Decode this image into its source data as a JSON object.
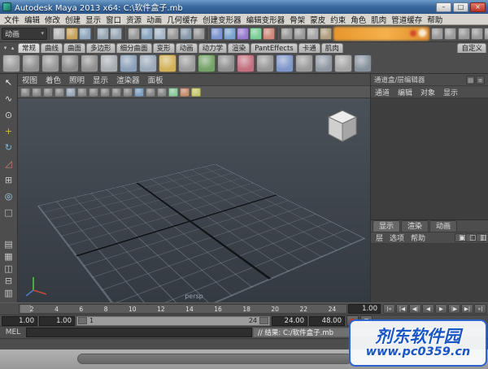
{
  "colors": {
    "titlebar_blue": "#3a6aa0",
    "ui_gray": "#4d4d4d",
    "viewport_bg": "#3e444b",
    "censor_orange": "#eb9c30",
    "watermark_blue": "#1a56c4",
    "field_bg": "#2b2b2b"
  },
  "window": {
    "title": "Autodesk Maya 2013 x64: C:\\软件盒子.mb",
    "controls": [
      {
        "name": "minimize-button",
        "glyph": "–"
      },
      {
        "name": "maximize-button",
        "glyph": "□"
      },
      {
        "name": "close-button",
        "glyph": "×"
      }
    ]
  },
  "menu_bar": {
    "items": [
      "文件",
      "编辑",
      "修改",
      "创建",
      "显示",
      "窗口",
      "资源",
      "动画",
      "几何缓存",
      "创建变形器",
      "编辑变形器",
      "骨架",
      "蒙皮",
      "约束",
      "角色",
      "肌肉",
      "管道缓存",
      "帮助"
    ]
  },
  "status_line": {
    "menu_set": "动画",
    "caret": "▾",
    "file_icons": [
      {
        "name": "new-scene-icon",
        "color": "#b8b8b8"
      },
      {
        "name": "open-scene-icon",
        "color": "#c9a45f"
      },
      {
        "name": "save-scene-icon",
        "color": "#8fa8bf"
      }
    ],
    "edit_icons": [
      {
        "name": "undo-icon",
        "color": "#9aa8b5"
      },
      {
        "name": "redo-icon",
        "color": "#9aa8b5"
      }
    ],
    "selection_icons": [
      {
        "name": "select-hierarchy-icon",
        "color": "#9a9a9a"
      },
      {
        "name": "select-object-icon",
        "color": "#8aa6c0"
      },
      {
        "name": "select-component-icon",
        "color": "#a8b8c8"
      },
      {
        "name": "select-mask-icon",
        "color": "#9a9a9a"
      },
      {
        "name": "highlight-selection-icon",
        "color": "#8a9aaa"
      },
      {
        "name": "select-rays-icon",
        "color": "#979797"
      }
    ],
    "snap_icons": [
      {
        "name": "snap-to-grid-icon",
        "color": "#7d95cf"
      },
      {
        "name": "snap-to-curve-icon",
        "color": "#7da5cf"
      },
      {
        "name": "snap-to-point-icon",
        "color": "#9a7dcf"
      },
      {
        "name": "snap-to-surface-icon",
        "color": "#7dcf9a"
      },
      {
        "name": "make-live-icon",
        "color": "#cf8a7d"
      }
    ],
    "history_icons": [
      {
        "name": "input-connections-icon",
        "color": "#9a9a9a"
      },
      {
        "name": "output-connections-icon",
        "color": "#9a9a9a"
      },
      {
        "name": "construction-history-icon",
        "color": "#a8a8a8"
      },
      {
        "name": "render-icon",
        "color": "#b0a080"
      }
    ],
    "after_icons": [
      {
        "name": "ipr-render-icon",
        "color": "#9a9a9a"
      },
      {
        "name": "render-settings-icon",
        "color": "#9a9a9a"
      }
    ],
    "right_icons": [
      {
        "name": "show-attribute-editor-icon",
        "color": "#9a9a9a"
      },
      {
        "name": "show-tool-settings-icon",
        "color": "#9a9a9a"
      },
      {
        "name": "show-channel-box-icon",
        "color": "#9a9a9a"
      }
    ]
  },
  "shelf": {
    "arrows": [
      {
        "name": "shelf-tab-menu-icon",
        "glyph": "▾"
      },
      {
        "name": "shelf-item-menu-icon",
        "glyph": "▴"
      }
    ],
    "tabs": [
      "常规",
      "曲线",
      "曲面",
      "多边形",
      "细分曲面",
      "变形",
      "动画",
      "动力学",
      "渲染",
      "PantEffects",
      "卡通",
      "肌肉"
    ],
    "custom_tab": "自定义",
    "icons": [
      {
        "name": "cv-curve-icon",
        "color": "#9a9a9a"
      },
      {
        "name": "ep-curve-icon",
        "color": "#8f8f8f"
      },
      {
        "name": "pencil-curve-icon",
        "color": "#969696"
      },
      {
        "name": "three-point-arc-icon",
        "color": "#8a8a8a"
      },
      {
        "name": "two-point-arc-icon",
        "color": "#909090"
      },
      {
        "name": "sphere-icon",
        "color": "#a8adb2"
      },
      {
        "name": "cube-icon",
        "color": "#8ba0b8"
      },
      {
        "name": "cylinder-icon",
        "color": "#9aa8b8"
      },
      {
        "name": "cone-icon",
        "color": "#d2b25a"
      },
      {
        "name": "plane-icon",
        "color": "#9a9a9a"
      },
      {
        "name": "torus-icon",
        "color": "#74a268"
      },
      {
        "name": "prism-icon",
        "color": "#8f8f8f"
      },
      {
        "name": "pyramid-icon",
        "color": "#c27080"
      },
      {
        "name": "pipe-icon",
        "color": "#979797"
      },
      {
        "name": "helix-icon",
        "color": "#7f97c9"
      },
      {
        "name": "soccer-ball-icon",
        "color": "#9a9a9a"
      },
      {
        "name": "platonic-solid-icon",
        "color": "#8f98a2"
      },
      {
        "name": "text-tool-icon",
        "color": "#a5a5a5"
      },
      {
        "name": "construction-plane-icon",
        "color": "#87919b"
      }
    ]
  },
  "toolbox": {
    "tools": [
      {
        "name": "select-tool-icon",
        "glyph": "↖",
        "color": "#f0f0f0"
      },
      {
        "name": "lasso-tool-icon",
        "glyph": "∿",
        "color": "#d8d8d8"
      },
      {
        "name": "paint-select-tool-icon",
        "glyph": "⊙",
        "color": "#d8d8d8"
      },
      {
        "name": "move-tool-icon",
        "glyph": "+",
        "color": "#d8b84a"
      },
      {
        "name": "rotate-tool-icon",
        "glyph": "↻",
        "color": "#7ab8d8"
      },
      {
        "name": "scale-tool-icon",
        "glyph": "◿",
        "color": "#d87a6a"
      },
      {
        "name": "universal-manipulator-icon",
        "glyph": "⊞",
        "color": "#c8c8c8"
      },
      {
        "name": "show-manipulator-icon",
        "glyph": "◎",
        "color": "#a8d8f0"
      },
      {
        "name": "last-tool-icon",
        "glyph": "□",
        "color": "#b8b8b8"
      }
    ],
    "layouts": [
      {
        "name": "layout-single-pane-icon",
        "glyph": "▤"
      },
      {
        "name": "layout-four-pane-icon",
        "glyph": "▦"
      },
      {
        "name": "layout-two-pane-icon",
        "glyph": "◫"
      },
      {
        "name": "layout-split-pane-icon",
        "glyph": "⊟"
      },
      {
        "name": "layout-outliner-pane-icon",
        "glyph": "▥"
      }
    ]
  },
  "viewport": {
    "menus": [
      "视图",
      "着色",
      "照明",
      "显示",
      "渲染器",
      "面板"
    ],
    "toolbar_icons": [
      {
        "name": "select-camera-icon",
        "color": "#8a8a8a"
      },
      {
        "name": "lock-camera-icon",
        "color": "#8a8a8a"
      },
      {
        "name": "camera-attributes-icon",
        "color": "#8a8a8a"
      },
      {
        "name": "bookmarks-icon",
        "color": "#8a8a8a"
      },
      {
        "name": "image-plane-icon",
        "color": "#9aa8b8"
      },
      {
        "name": "two-d-pan-zoom-icon",
        "color": "#8a8a8a"
      },
      {
        "name": "grease-pencil-icon",
        "color": "#8a8a8a"
      },
      {
        "name": "film-gate-icon",
        "color": "#8a8a8a"
      },
      {
        "name": "resolution-gate-icon",
        "color": "#8a8a8a"
      },
      {
        "name": "gate-mask-icon",
        "color": "#8a8a8a"
      },
      {
        "name": "field-chart-icon",
        "color": "#7fa0c0"
      },
      {
        "name": "safe-action-icon",
        "color": "#8a8a8a"
      },
      {
        "name": "safe-title-icon",
        "color": "#8a8a8a"
      },
      {
        "name": "wireframe-icon",
        "color": "#8fc9a0"
      },
      {
        "name": "shaded-icon",
        "color": "#c98f6f"
      },
      {
        "name": "textured-icon",
        "color": "#c9c96f"
      }
    ],
    "camera_label": "persp"
  },
  "channel_box": {
    "title": "通道盒/层编辑器",
    "header_icons": [
      {
        "name": "channel-box-tab-icon",
        "glyph": "▤"
      },
      {
        "name": "layer-editor-tab-icon",
        "glyph": "≡"
      }
    ],
    "menus": [
      "通道",
      "编辑",
      "对象",
      "显示"
    ]
  },
  "layer_editor": {
    "tabs": [
      "显示",
      "渲染",
      "动画"
    ],
    "menus": [
      "层",
      "选项",
      "帮助"
    ],
    "buttons": [
      {
        "name": "new-empty-layer-icon",
        "glyph": "▣"
      },
      {
        "name": "new-layer-from-selected-icon",
        "glyph": "▢"
      },
      {
        "name": "layer-options-icon",
        "glyph": "▥"
      }
    ]
  },
  "timeline": {
    "ticks": [
      "2",
      "4",
      "6",
      "8",
      "10",
      "12",
      "14",
      "16",
      "18",
      "20",
      "22",
      "24"
    ],
    "current_time": "1.00",
    "transport": [
      {
        "name": "go-to-start-button",
        "glyph": "|«"
      },
      {
        "name": "step-back-frame-button",
        "glyph": "|◀"
      },
      {
        "name": "step-back-key-button",
        "glyph": "◀|"
      },
      {
        "name": "play-backwards-button",
        "glyph": "◀"
      },
      {
        "name": "play-forwards-button",
        "glyph": "▶"
      },
      {
        "name": "step-forward-key-button",
        "glyph": "|▶"
      },
      {
        "name": "step-forward-frame-button",
        "glyph": "▶|"
      },
      {
        "name": "go-to-end-button",
        "glyph": "»|"
      }
    ]
  },
  "range": {
    "anim_start": "1.00",
    "playback_start": "1.00",
    "range_start_label": "1",
    "range_end_label": "24",
    "playback_end": "24.00",
    "anim_end": "48.00"
  },
  "command_line": {
    "label": "MEL",
    "result": "// 结果: C:/软件盒子.mb"
  },
  "watermark": {
    "line1": "剂东软件园",
    "line2": "www.pc0359.cn"
  }
}
